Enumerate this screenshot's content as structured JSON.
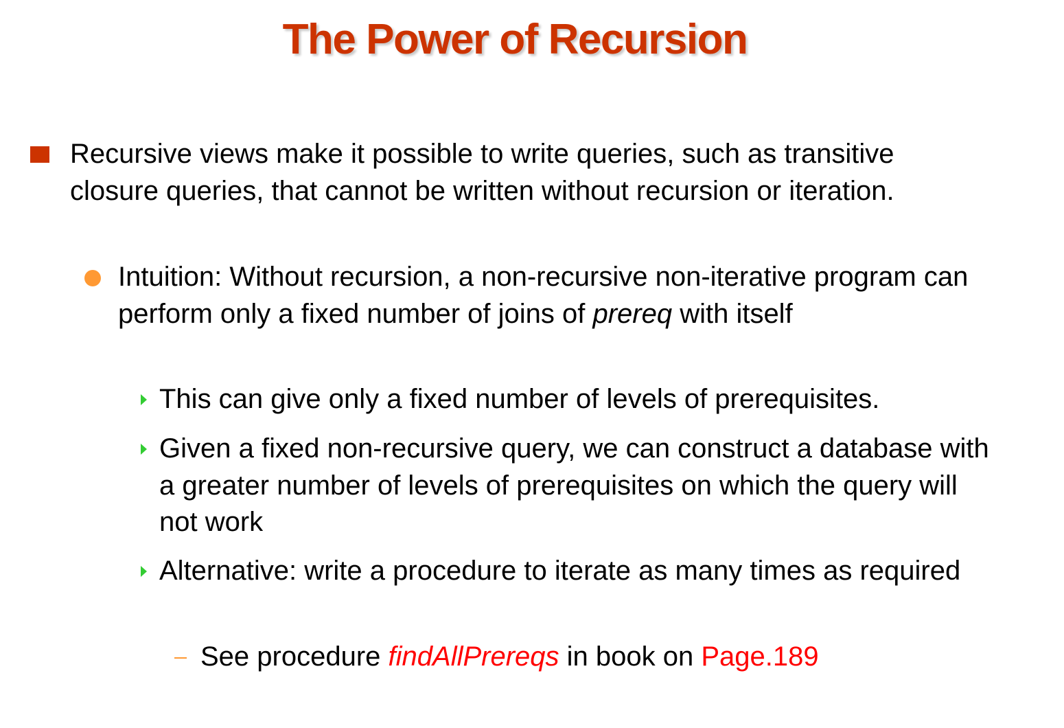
{
  "slide": {
    "title": "The Power of Recursion",
    "colors": {
      "title": "#cc3300",
      "level1_bullet": "#cc3300",
      "level2_bullet": "#ff9933",
      "level3_bullet": "#33cc33",
      "level4_bullet": "#ff9933",
      "highlight": "#ff0000"
    },
    "bullets": {
      "level1": "Recursive views make it possible to write queries, such as transitive closure queries, that cannot be written without recursion or iteration.",
      "level2": {
        "text_before": "Intuition:  Without recursion, a non-recursive non-iterative program can perform only a fixed number of joins of ",
        "emphasis": "prereq",
        "text_after": " with itself"
      },
      "level3": [
        "This can give only a fixed number of levels of prerequisites.",
        " Given a fixed non-recursive query, we can construct a database with a greater number of levels of prerequisites on which the query will not work",
        "Alternative: write a procedure to iterate as many times as required"
      ],
      "level4": {
        "text_before": "See procedure ",
        "procedure_name": "findAllPrereqs",
        "text_middle": " in book on ",
        "page_ref": "Page.189"
      }
    }
  }
}
